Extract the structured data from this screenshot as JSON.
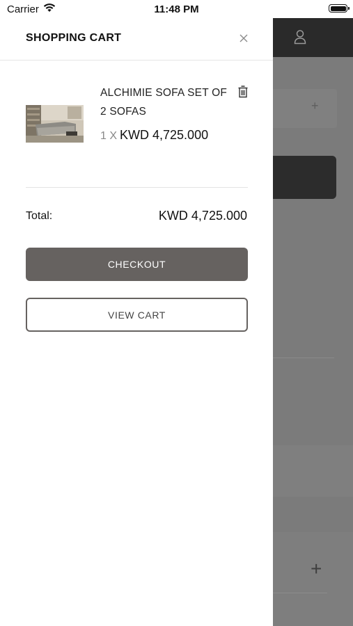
{
  "status_bar": {
    "carrier": "Carrier",
    "time": "11:48 PM"
  },
  "cart": {
    "title": "SHOPPING CART",
    "items": [
      {
        "name": "ALCHIMIE SOFA SET OF 2 SOFAS",
        "qty_label": "1 X",
        "price": "KWD 4,725.000"
      }
    ],
    "total_label": "Total:",
    "total_value": "KWD 4,725.000",
    "checkout_label": "CHECKOUT",
    "view_cart_label": "VIEW CART"
  },
  "background_page": {
    "plus_small": "+",
    "plus_large": "+"
  },
  "icons": [
    "wifi-icon",
    "battery-icon",
    "close-icon",
    "trash-icon",
    "user-icon",
    "plus-icon"
  ]
}
